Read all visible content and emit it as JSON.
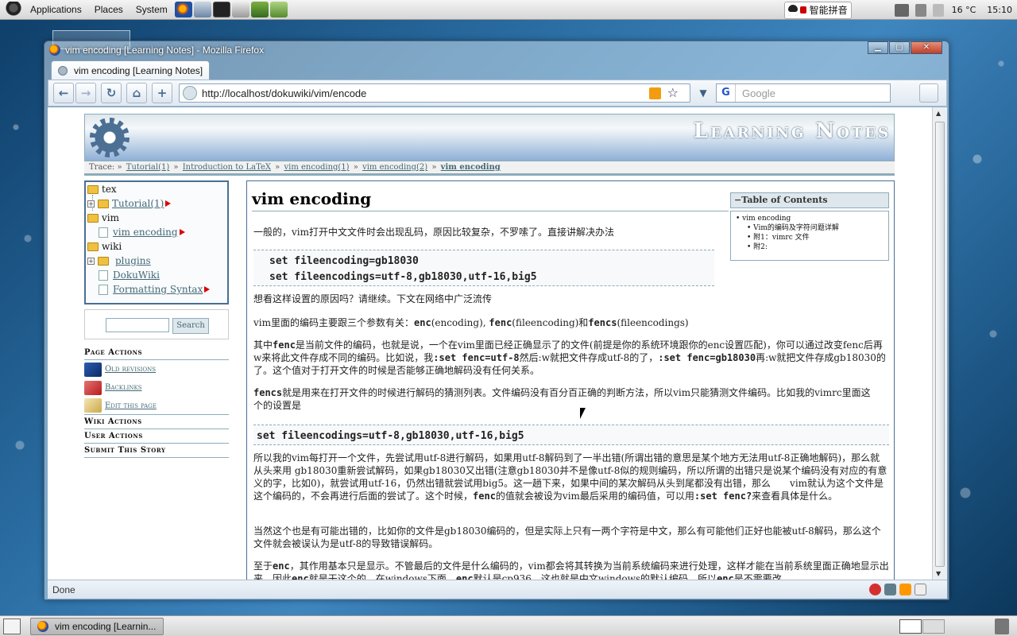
{
  "top_panel": {
    "menus": [
      "Applications",
      "Places",
      "System"
    ],
    "ime": "智能拼音",
    "temperature": "16 °C",
    "clock": "15:10"
  },
  "window": {
    "title": "vim encoding [Learning Notes] - Mozilla Firefox",
    "tab_title": "vim encoding [Learning Notes]",
    "url": "http://localhost/dokuwiki/vim/encode",
    "search_placeholder": "Google",
    "status": "Done"
  },
  "wiki": {
    "site_title": "Learning Notes",
    "trace_label": "Trace:",
    "breadcrumbs": [
      "Tutorial(1)",
      "Introduction to LaTeX",
      "vim encoding(1)",
      "vim encoding(2)",
      "vim encoding"
    ],
    "tree": {
      "tex": "tex",
      "tutorial": "Tutorial(1)",
      "vim": "vim",
      "vim_encoding": "vim encoding",
      "wiki": "wiki",
      "plugins": "plugins",
      "dokuwiki": "DokuWiki",
      "formatting_syntax": "Formatting Syntax"
    },
    "search_button": "Search",
    "page_actions": {
      "heading": "Page Actions",
      "old_revisions": "Old revisions",
      "backlinks": "Backlinks",
      "edit": "Edit this page"
    },
    "wiki_actions": "Wiki Actions",
    "user_actions": "User Actions",
    "submit_story": "Submit This Story"
  },
  "article": {
    "heading": "vim encoding",
    "toc": {
      "title": "Table of Contents",
      "toggle": "−",
      "items": [
        "vim encoding",
        "Vim的编码及字符问题详解",
        "附1：vimrc 文件",
        "附2:"
      ]
    },
    "p1": "一般的，vim打开中文文件时会出现乱码，原因比较复杂，不罗嗦了。直接讲解决办法",
    "code1_line1": "set fileencoding=gb18030",
    "code1_line2": "set fileencodings=utf-8,gb18030,utf-16,big5",
    "p2": "想看这样设置的原因吗？请继续。下文在网络中广泛流传",
    "p3": {
      "a": "vim里面的编码主要跟三个参数有关：",
      "enc": "enc",
      "b": "(encoding), ",
      "fenc": "fenc",
      "c": "(fileencoding)和",
      "fencs": "fencs",
      "d": "(fileencodings)"
    },
    "p4": {
      "a": "其中",
      "fenc": "fenc",
      "b": "是当前文件的编码，也就是说，一个在vim里面已经正确显示了的文件(前提是你的系统环境跟你的enc设置匹配)，你可以通过改变fenc后再w来将此文件存成不同的编码。比如说，我",
      "cmd1": ":set fenc=utf-8",
      "c": "然后:w就把文件存成utf-8的了，",
      "cmd2": ":set fenc=gb18030",
      "d": "再:w就把文件存成gb18030的了。这个值对于打开文件的时候是否能够正确地解码没有任何关系。"
    },
    "p5": {
      "fencs": "fencs",
      "a": "就是用来在打开文件的时候进行解码的猜测列表。文件编码没有百分百正确的判断方法，所以vim只能猜测文件编码。比如我的vimrc里面这个的设置是"
    },
    "code2": "set fileencodings=utf-8,gb18030,utf-16,big5",
    "p6": {
      "a": "所以我的vim每打开一个文件，先尝试用utf-8进行解码，如果用utf-8解码到了一半出错(所谓出错的意思是某个地方无法用utf-8正确地解码)，那么就从头来用 gb18030重新尝试解码，如果gb18030又出错(注意gb18030并不是像utf-8似的规则编码，所以所谓的出错只是说某个编码没有对应的有意义的字，比如0)，就尝试用utf-16，仍然出错就尝试用big5。这一趟下来，如果中间的某次解码从头到尾都没有出错，那么　　vim就认为这个文件是这个编码的，不会再进行后面的尝试了。这个时候，",
      "fenc": "fenc",
      "b": "的值就会被设为vim最后采用的编码值，可以用",
      "cmd": ":set fenc?",
      "c": "来查看具体是什么。"
    },
    "p7": "当然这个也是有可能出错的，比如你的文件是gb18030编码的，但是实际上只有一两个字符是中文，那么有可能他们正好也能被utf-8解码，那么这个文件就会被误认为是utf-8的导致错误解码。",
    "p8": {
      "a": "至于",
      "enc": "enc",
      "b": "，其作用基本只是显示。不管最后的文件是什么编码的，vim都会将其转换为当前系统编码来进行处理，这样才能在当前系统里面正确地显示出来，因此",
      "enc2": "enc",
      "c": "就是干这个的。在windows下面，",
      "enc3": "enc",
      "d": "默认是cp936，这也就是中文windows的默认编码，所以",
      "enc4": "enc",
      "e": "是不需要改"
    }
  },
  "taskbar": {
    "task_label": "vim encoding [Learnin..."
  },
  "colors": {
    "wiki_border": "#8cacbb",
    "link": "#436976",
    "desktop": "#2b6ea3"
  }
}
